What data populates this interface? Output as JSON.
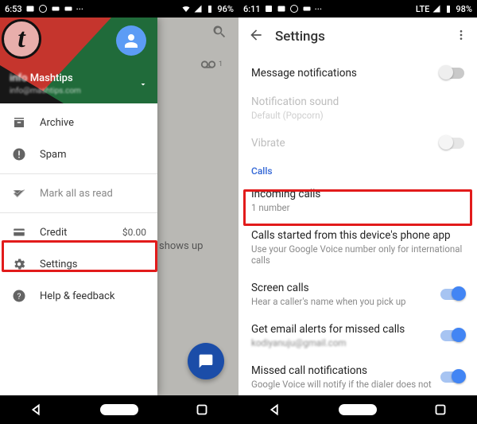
{
  "phone1": {
    "status": {
      "time": "6:53",
      "battery": "96%"
    },
    "overlay_logo": "t",
    "drawer": {
      "account_name": "Mashtips",
      "account_email": "info@mashtips.com",
      "items": [
        {
          "icon": "archive",
          "label": "Archive"
        },
        {
          "icon": "spam",
          "label": "Spam"
        },
        {
          "icon": "mark",
          "label": "Mark all as read"
        },
        {
          "icon": "credit",
          "label": "Credit",
          "trail": "$0.00"
        },
        {
          "icon": "settings",
          "label": "Settings"
        },
        {
          "icon": "help",
          "label": "Help & feedback"
        }
      ]
    },
    "voicemail_badge": "1",
    "empty_hint": "shows up"
  },
  "phone2": {
    "status": {
      "time": "6:11",
      "network": "LTE",
      "battery": "98%"
    },
    "title": "Settings",
    "rows": {
      "msg_notif": {
        "title": "Message notifications",
        "toggle": "off"
      },
      "notif_sound": {
        "title": "Notification sound",
        "sub": "Default (Popcorn)"
      },
      "vibrate": {
        "title": "Vibrate",
        "toggle": "off"
      },
      "section_calls": "Calls",
      "incoming": {
        "title": "Incoming calls",
        "sub": "1 number"
      },
      "calls_started": {
        "title": "Calls started from this device's phone app",
        "sub": "Use your Google Voice number only for international calls"
      },
      "screen": {
        "title": "Screen calls",
        "sub": "Hear a caller's name when you pick up",
        "toggle": "on"
      },
      "email_alerts": {
        "title": "Get email alerts for missed calls",
        "sub": "kodiyanuju@gmail.com",
        "toggle": "on"
      },
      "missed": {
        "title": "Missed call notifications",
        "sub": "Google Voice will notify if the dialer does not",
        "toggle": "on"
      }
    }
  }
}
